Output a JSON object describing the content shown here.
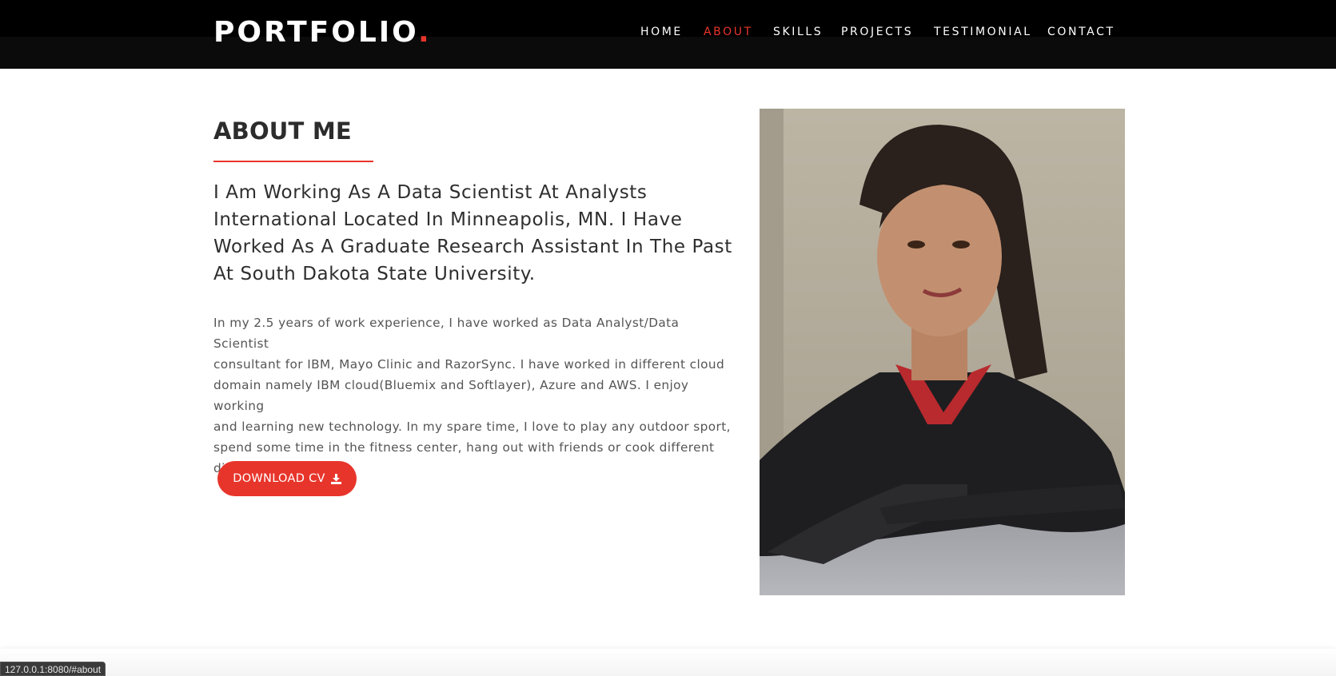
{
  "brand": {
    "name": "PORTFOLIO",
    "dot": "."
  },
  "nav": {
    "items": [
      {
        "label": "HOME"
      },
      {
        "label": "ABOUT",
        "active": true
      },
      {
        "label": "SKILLS"
      },
      {
        "label": "PROJECTS"
      },
      {
        "label": "TESTIMONIAL"
      },
      {
        "label": "CONTACT"
      }
    ]
  },
  "about": {
    "title": "ABOUT ME",
    "lead_lines": [
      "I Am Working As A Data Scientist At Analysts",
      "International Located In Minneapolis, MN. I Have",
      "Worked As A Graduate Research Assistant In The Past",
      "At South Dakota State University."
    ],
    "body_lines": [
      "In my 2.5 years of work experience, I have worked as Data Analyst/Data Scientist",
      "consultant for IBM, Mayo Clinic and RazorSync. I have worked in different cloud",
      "domain namely IBM cloud(Bluemix and Softlayer), Azure and AWS. I enjoy working",
      "and learning new technology. In my spare time, I love to play any outdoor sport,",
      "spend some time in the fitness center, hang out with friends or cook different",
      "dishes in the kitchen."
    ],
    "button_label": "DOWNLOAD CV",
    "button_icon": "download-icon"
  },
  "status_bar": {
    "url": "127.0.0.1:8080/#about"
  },
  "colors": {
    "accent": "#e8352b",
    "header": "#0b0b0b",
    "text": "#2e2e2e"
  }
}
